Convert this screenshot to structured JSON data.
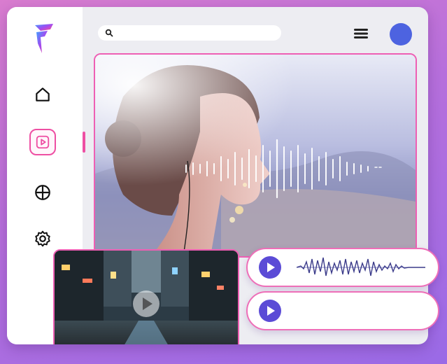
{
  "search": {
    "value": "",
    "placeholder": ""
  },
  "colors": {
    "accent": "#ee4fa3",
    "avatar": "#4d63e0",
    "play": "#5b4bd6"
  },
  "sidebar": {
    "items": [
      {
        "icon": "home-icon"
      },
      {
        "icon": "play-square-icon",
        "active": true
      },
      {
        "icon": "pie-chart-icon"
      },
      {
        "icon": "gear-icon"
      }
    ]
  },
  "audio_tracks": [
    {
      "icon": "play-icon",
      "waveform": "outline"
    },
    {
      "icon": "play-icon",
      "waveform": "bars"
    }
  ]
}
